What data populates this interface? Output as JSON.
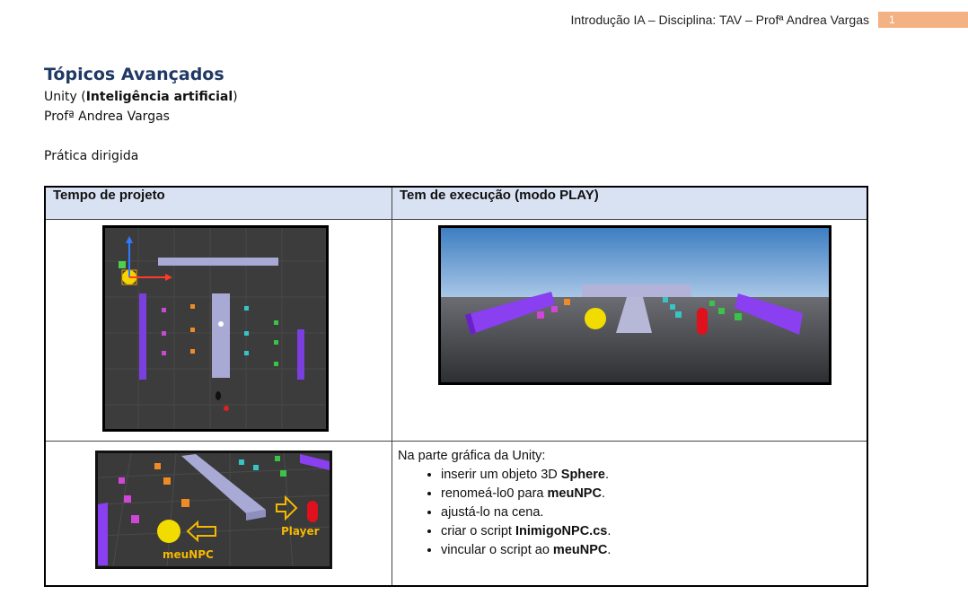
{
  "header": {
    "text": "Introdução IA – Disciplina: TAV – Profª Andrea Vargas",
    "page_number": "1"
  },
  "title": "Tópicos Avançados",
  "subtitle": {
    "prefix": "Unity (",
    "bold": "Inteligência artificial",
    "suffix": ")"
  },
  "author": "Profª Andrea Vargas",
  "section": "Prática dirigida",
  "table": {
    "col1_header": "Tempo de projeto",
    "col2_header": "Tem de execução (modo PLAY)",
    "intro": "Na parte gráfica da Unity:",
    "steps": [
      {
        "pre": "inserir um objeto 3D ",
        "bold": "Sphere",
        "post": "."
      },
      {
        "pre": "renomeá-lo0 para ",
        "bold": "meuNPC",
        "post": "."
      },
      {
        "pre": "ajustá-lo na cena.",
        "bold": "",
        "post": ""
      },
      {
        "pre": "criar o script ",
        "bold": "InimigoNPC.cs",
        "post": "."
      },
      {
        "pre": "vincular o script ao ",
        "bold": "meuNPC",
        "post": "."
      }
    ],
    "image_labels": {
      "player": "Player",
      "npc": "meuNPC"
    }
  }
}
